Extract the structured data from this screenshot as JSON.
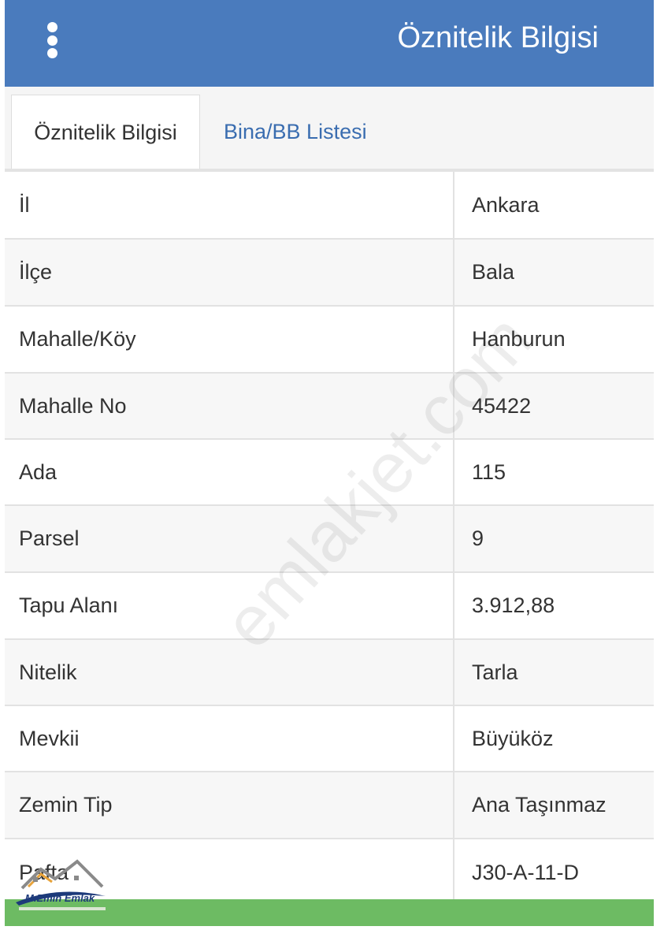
{
  "header": {
    "title": "Öznitelik Bilgisi",
    "menu_icon": "vertical-dots-icon"
  },
  "tabs": [
    {
      "label": "Öznitelik Bilgisi",
      "active": true
    },
    {
      "label": "Bina/BB Listesi",
      "active": false
    }
  ],
  "rows": [
    {
      "label": "İl",
      "value": "Ankara"
    },
    {
      "label": "İlçe",
      "value": "Bala"
    },
    {
      "label": "Mahalle/Köy",
      "value": "Hanburun"
    },
    {
      "label": "Mahalle No",
      "value": "45422"
    },
    {
      "label": "Ada",
      "value": "115"
    },
    {
      "label": "Parsel",
      "value": "9"
    },
    {
      "label": "Tapu Alanı",
      "value": "3.912,88"
    },
    {
      "label": "Nitelik",
      "value": "Tarla"
    },
    {
      "label": "Mevkii",
      "value": "Büyüköz"
    },
    {
      "label": "Zemin Tip",
      "value": "Ana Taşınmaz"
    },
    {
      "label": "Pafta",
      "value": "J30-A-11-D"
    }
  ],
  "watermark": "emlakjet.com",
  "logo": {
    "name": "M.Emin Emlak"
  },
  "colors": {
    "header": "#4a7bbd",
    "tab_link": "#3a6db0",
    "footer": "#6dbb63"
  }
}
